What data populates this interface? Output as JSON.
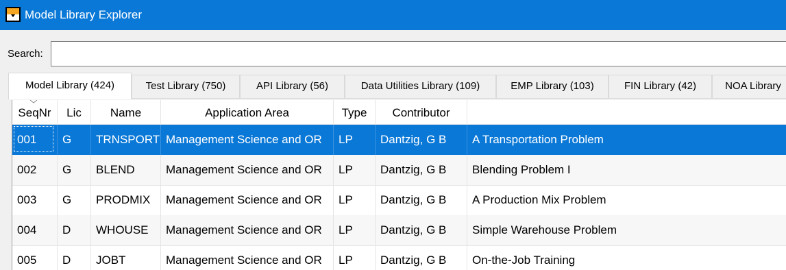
{
  "window": {
    "title": "Model Library Explorer"
  },
  "search": {
    "label": "Search:",
    "value": ""
  },
  "tabs": [
    {
      "label": "Model Library (424)",
      "active": true
    },
    {
      "label": "Test Library (750)",
      "active": false
    },
    {
      "label": "API Library (56)",
      "active": false
    },
    {
      "label": "Data Utilities Library (109)",
      "active": false
    },
    {
      "label": "EMP Library (103)",
      "active": false
    },
    {
      "label": "FIN Library (42)",
      "active": false
    },
    {
      "label": "NOA Library",
      "active": false
    }
  ],
  "table": {
    "columns": [
      "SeqNr",
      "Lic",
      "Name",
      "Application Area",
      "Type",
      "Contributor",
      ""
    ],
    "sorted_column": "SeqNr",
    "rows": [
      {
        "seqnr": "001",
        "lic": "G",
        "name": "TRNSPORT",
        "area": "Management Science and OR",
        "type": "LP",
        "contributor": "Dantzig, G B",
        "description": "A Transportation Problem",
        "selected": true
      },
      {
        "seqnr": "002",
        "lic": "G",
        "name": "BLEND",
        "area": "Management Science and OR",
        "type": "LP",
        "contributor": "Dantzig, G B",
        "description": "Blending Problem I",
        "selected": false
      },
      {
        "seqnr": "003",
        "lic": "G",
        "name": "PRODMIX",
        "area": "Management Science and OR",
        "type": "LP",
        "contributor": "Dantzig, G B",
        "description": "A Production Mix Problem",
        "selected": false
      },
      {
        "seqnr": "004",
        "lic": "D",
        "name": "WHOUSE",
        "area": "Management Science and OR",
        "type": "LP",
        "contributor": "Dantzig, G B",
        "description": "Simple Warehouse Problem",
        "selected": false
      },
      {
        "seqnr": "005",
        "lic": "D",
        "name": "JOBT",
        "area": "Management Science and OR",
        "type": "LP",
        "contributor": "Dantzig, G B",
        "description": "On-the-Job Training",
        "selected": false
      }
    ]
  },
  "colors": {
    "titlebar": "#0a78d7",
    "selection": "#0a78d7",
    "selection_text": "#ffffff"
  },
  "icons": {
    "app": "model-library-app-icon",
    "sort": "sort-chevron-down-icon"
  }
}
